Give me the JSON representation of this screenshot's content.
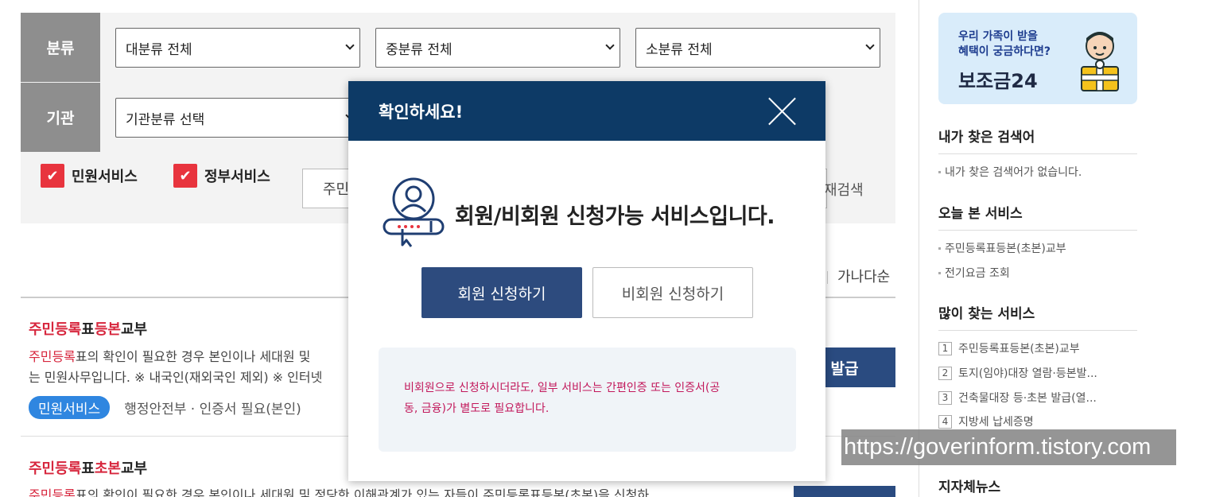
{
  "filter": {
    "category_label": "분류",
    "agency_label": "기관",
    "major_select": "대분류 전체",
    "middle_select": "중분류 전체",
    "minor_select": "소분류 전체",
    "agency_select": "기관분류 선택",
    "chk_civil": "민원서비스",
    "chk_gov": "정부서비스",
    "search_value": "주민",
    "research_label": "재검색"
  },
  "sort": {
    "label": "가나다순"
  },
  "results": [
    {
      "title_hl1": "주민등록",
      "title_mid1": "표",
      "title_hl2": "등본",
      "title_end": "교부",
      "desc1_hl": "주민등록",
      "desc1_rest": "표의 확인이 필요한 경우 본인이나 세대원 및",
      "desc2": "는 민원사무입니다. ※ 내국인(재외국인 제외) ※ 인터넷",
      "tag": "민원서비스",
      "meta": "행정안전부 ·  인증서 필요(본인)",
      "button": "발급"
    },
    {
      "title_hl1": "주민등록",
      "title_mid1": "표",
      "title_hl2": "초본",
      "title_end": "교부",
      "desc1_hl": "주민등록",
      "desc1_rest": "표의 확인이 필요한 경우 본인이나 세대원 및 정당한 이해관계가 있는 자들이 주민등록표등본(초본)을 신청하"
    }
  ],
  "sidebar": {
    "banner_line1": "우리 가족이 받을",
    "banner_line2": "혜택이 궁금하다면?",
    "banner_title": "보조금24",
    "searched_title": "내가 찾은 검색어",
    "searched_empty": "내가 찾은 검색어가 없습니다.",
    "today_title": "오늘 본 서비스",
    "today_items": [
      "주민등록표등본(초본)교부",
      "전기요금 조회"
    ],
    "popular_title": "많이 찾는 서비스",
    "popular_items": [
      {
        "rank": "1",
        "label": "주민등록표등본(초본)교부"
      },
      {
        "rank": "2",
        "label": "토지(임야)대장 열람·등본발..."
      },
      {
        "rank": "3",
        "label": "건축물대장 등·초본 발급(열..."
      },
      {
        "rank": "4",
        "label": "지방세 납세증명"
      }
    ],
    "local_news_title": "지자체뉴스"
  },
  "watermark": "https://goverinform.tistory.com",
  "modal": {
    "title": "확인하세요!",
    "message": "회원/비회원 신청가능 서비스입니다.",
    "member_button": "회원 신청하기",
    "guest_button": "비회원 신청하기",
    "notice_line1": "비회원으로 신청하시더라도, 일부 서비스는 간편인증 또는 인증서(공",
    "notice_line2": "동, 금융)가 별도로 필요합니다."
  },
  "colors": {
    "modal_header": "#0d3a66",
    "member_button": "#2d4b7e",
    "highlight_red": "#d7263d",
    "checkbox_red": "#e8343e",
    "tag_blue": "#2f86e0"
  }
}
